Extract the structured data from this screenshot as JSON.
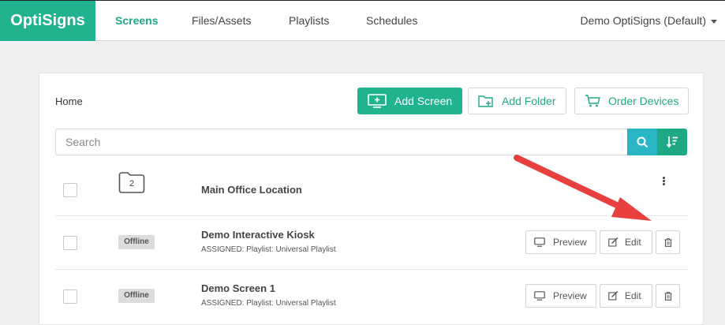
{
  "app": {
    "brand": "OptiSigns"
  },
  "nav": {
    "items": [
      {
        "label": "Screens",
        "active": true
      },
      {
        "label": "Files/Assets",
        "active": false
      },
      {
        "label": "Playlists",
        "active": false
      },
      {
        "label": "Schedules",
        "active": false
      }
    ],
    "account": "Demo OptiSigns (Default)"
  },
  "toolbar": {
    "breadcrumb": "Home",
    "add_screen": "Add Screen",
    "add_folder": "Add Folder",
    "order_devices": "Order Devices"
  },
  "search": {
    "placeholder": "Search",
    "value": ""
  },
  "folders": [
    {
      "name": "Main Office Location",
      "count": "2"
    }
  ],
  "screens": [
    {
      "name": "Demo Interactive Kiosk",
      "status": "Offline",
      "assigned": "ASSIGNED: Playlist: Universal Playlist"
    },
    {
      "name": "Demo Screen 1",
      "status": "Offline",
      "assigned": "ASSIGNED: Playlist: Universal Playlist"
    }
  ],
  "actions": {
    "preview": "Preview",
    "edit": "Edit"
  },
  "colors": {
    "brand": "#21b38f",
    "search": "#2ab7c5",
    "annotation_arrow": "#e8403f"
  }
}
